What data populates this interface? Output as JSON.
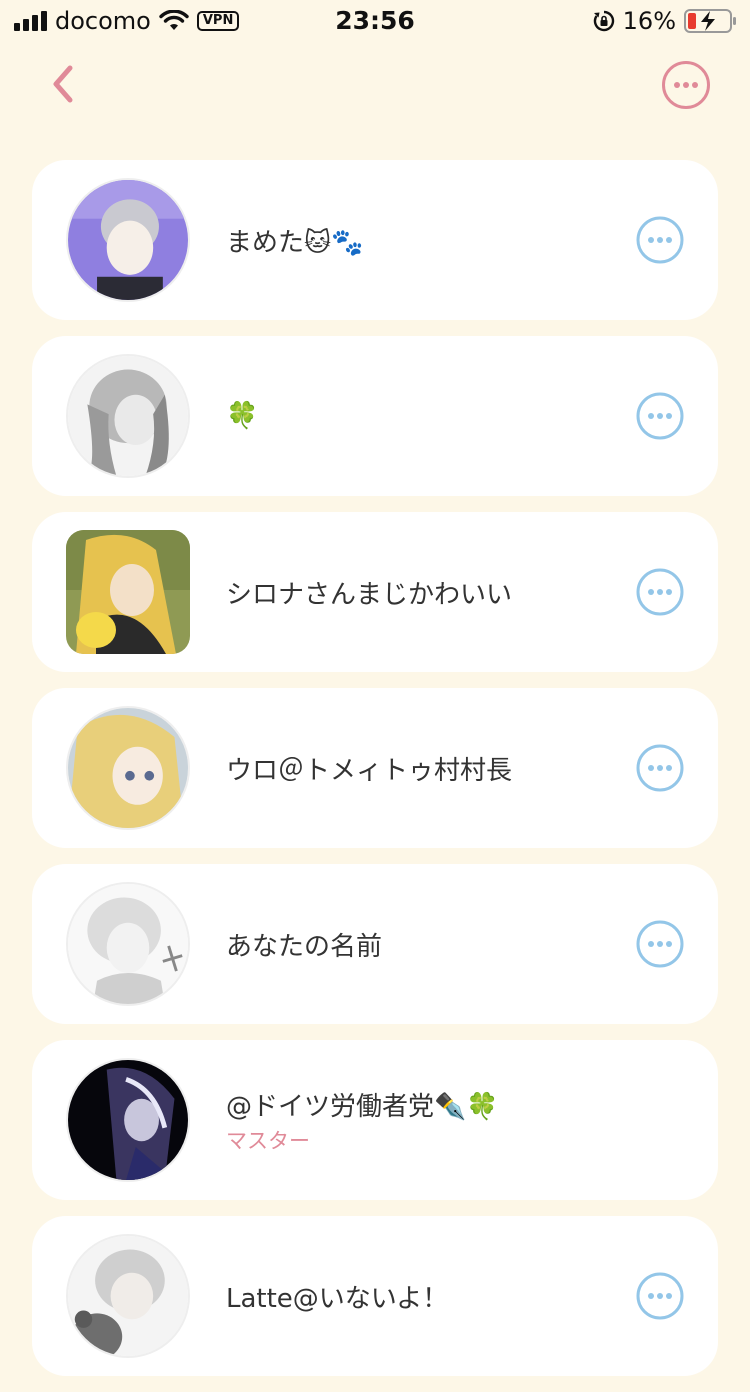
{
  "status_bar": {
    "carrier": "docomo",
    "vpn": "VPN",
    "time": "23:56",
    "battery_percent": "16%"
  },
  "colors": {
    "background": "#fdf7e7",
    "accent_pink": "#e08a98",
    "more_blue": "#93c6e8"
  },
  "nav": {
    "back_icon": "chevron-left-icon",
    "more_icon": "more-circle-icon"
  },
  "members": [
    {
      "name": "まめた🐱🐾",
      "role": "",
      "avatar_shape": "circle"
    },
    {
      "name": "🍀",
      "role": "",
      "avatar_shape": "circle"
    },
    {
      "name": "シロナさんまじかわいい",
      "role": "",
      "avatar_shape": "square"
    },
    {
      "name": "ウロ＠トメィトゥ村村長",
      "role": "",
      "avatar_shape": "circle"
    },
    {
      "name": "あなたの名前",
      "role": "",
      "avatar_shape": "circle"
    },
    {
      "name": "@ドイツ労働者党✒️🍀",
      "role": "マスター",
      "avatar_shape": "circle"
    },
    {
      "name": "Latte@いないよ！",
      "role": "",
      "avatar_shape": "circle"
    }
  ]
}
